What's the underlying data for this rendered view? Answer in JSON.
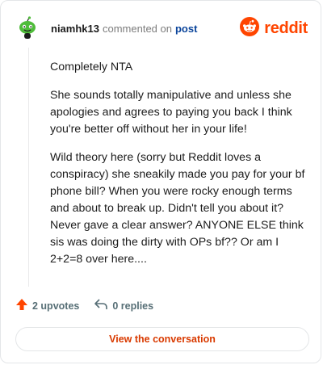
{
  "header": {
    "username": "niamhk13",
    "action_text": "commented on",
    "post_link": "post",
    "brand_name": "reddit"
  },
  "comment": {
    "paragraphs": [
      "Completely NTA",
      "She sounds totally manipulative and unless she apologies and agrees to paying you back I think you're better off without her in your life!",
      "Wild theory here (sorry but Reddit loves a conspiracy) she sneakily made you pay for your bf phone bill? When you were rocky enough terms and about to break up. Didn't tell you about it? Never gave a clear answer? ANYONE ELSE think sis was doing the dirty with OPs bf?? Or am I 2+2=8 over here...."
    ]
  },
  "footer": {
    "upvotes_label": "2 upvotes",
    "replies_label": "0 replies"
  },
  "cta": {
    "label": "View the conversation"
  },
  "colors": {
    "brand": "#ff4500",
    "upvote": "#ff4500",
    "cta_text": "#d93a00",
    "link": "#0a449b",
    "avatar_green": "#4fbc3a"
  },
  "icons": {
    "avatar": "snoo-avatar-icon",
    "brand": "reddit-logo-icon",
    "upvote": "upvote-arrow-icon",
    "reply": "reply-arrow-icon"
  }
}
